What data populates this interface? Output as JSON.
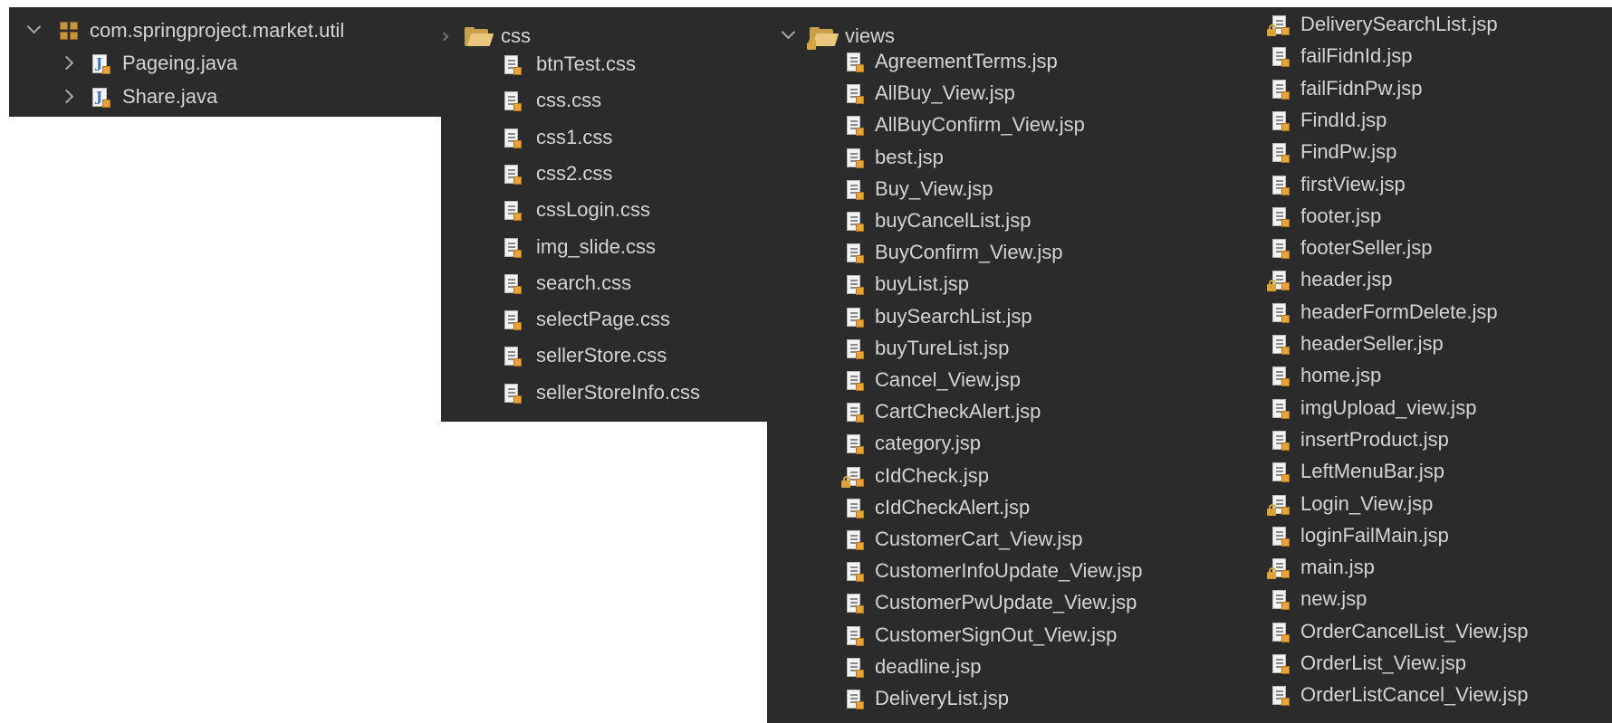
{
  "util_panel": {
    "package": "com.springproject.market.util",
    "files": [
      "Pageing.java",
      "Share.java"
    ]
  },
  "css_panel": {
    "folder": "css",
    "files": [
      "btnTest.css",
      "css.css",
      "css1.css",
      "css2.css",
      "cssLogin.css",
      "img_slide.css",
      "search.css",
      "selectPage.css",
      "sellerStore.css",
      "sellerStoreInfo.css"
    ]
  },
  "views_panel": {
    "folder": "views",
    "left_files": [
      {
        "name": "AgreementTerms.jsp",
        "locked": false
      },
      {
        "name": "AllBuy_View.jsp",
        "locked": false
      },
      {
        "name": "AllBuyConfirm_View.jsp",
        "locked": false
      },
      {
        "name": "best.jsp",
        "locked": false
      },
      {
        "name": "Buy_View.jsp",
        "locked": false
      },
      {
        "name": "buyCancelList.jsp",
        "locked": false
      },
      {
        "name": "BuyConfirm_View.jsp",
        "locked": false
      },
      {
        "name": "buyList.jsp",
        "locked": false
      },
      {
        "name": "buySearchList.jsp",
        "locked": false
      },
      {
        "name": "buyTureList.jsp",
        "locked": false
      },
      {
        "name": "Cancel_View.jsp",
        "locked": false
      },
      {
        "name": "CartCheckAlert.jsp",
        "locked": false
      },
      {
        "name": "category.jsp",
        "locked": false
      },
      {
        "name": "cIdCheck.jsp",
        "locked": true
      },
      {
        "name": "cIdCheckAlert.jsp",
        "locked": false
      },
      {
        "name": "CustomerCart_View.jsp",
        "locked": false
      },
      {
        "name": "CustomerInfoUpdate_View.jsp",
        "locked": false
      },
      {
        "name": "CustomerPwUpdate_View.jsp",
        "locked": false
      },
      {
        "name": "CustomerSignOut_View.jsp",
        "locked": false
      },
      {
        "name": "deadline.jsp",
        "locked": false
      },
      {
        "name": "DeliveryList.jsp",
        "locked": false
      }
    ],
    "right_files": [
      {
        "name": "DeliverySearchList.jsp",
        "locked": true
      },
      {
        "name": "failFidnId.jsp",
        "locked": false
      },
      {
        "name": "failFidnPw.jsp",
        "locked": false
      },
      {
        "name": "FindId.jsp",
        "locked": false
      },
      {
        "name": "FindPw.jsp",
        "locked": false
      },
      {
        "name": "firstView.jsp",
        "locked": false
      },
      {
        "name": "footer.jsp",
        "locked": false
      },
      {
        "name": "footerSeller.jsp",
        "locked": false
      },
      {
        "name": "header.jsp",
        "locked": true
      },
      {
        "name": "headerFormDelete.jsp",
        "locked": false
      },
      {
        "name": "headerSeller.jsp",
        "locked": false
      },
      {
        "name": "home.jsp",
        "locked": false
      },
      {
        "name": "imgUpload_view.jsp",
        "locked": false
      },
      {
        "name": "insertProduct.jsp",
        "locked": false
      },
      {
        "name": "LeftMenuBar.jsp",
        "locked": false
      },
      {
        "name": "Login_View.jsp",
        "locked": true
      },
      {
        "name": "loginFailMain.jsp",
        "locked": false
      },
      {
        "name": "main.jsp",
        "locked": true
      },
      {
        "name": "new.jsp",
        "locked": false
      },
      {
        "name": "OrderCancelList_View.jsp",
        "locked": false
      },
      {
        "name": "OrderList_View.jsp",
        "locked": false
      },
      {
        "name": "OrderListCancel_View.jsp",
        "locked": false
      }
    ]
  }
}
